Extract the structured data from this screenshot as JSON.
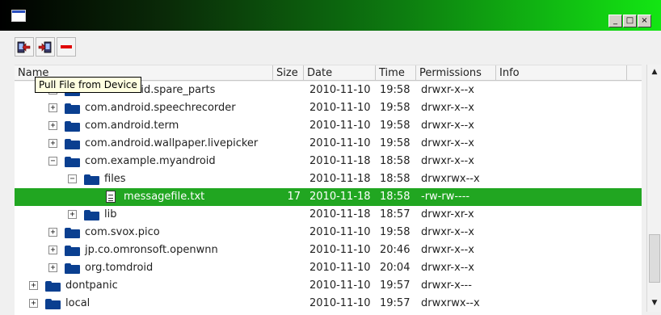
{
  "window": {
    "controls": {
      "minimize": "_",
      "maximize": "□",
      "close": "×"
    }
  },
  "toolbar": {
    "buttons": [
      {
        "name": "pull-file-button",
        "icon": "pull-file-icon"
      },
      {
        "name": "push-file-button",
        "icon": "push-file-icon"
      },
      {
        "name": "delete-button",
        "icon": "minus-icon"
      }
    ]
  },
  "tooltip": "Pull File from Device",
  "columns": [
    "Name",
    "Size",
    "Date",
    "Time",
    "Permissions",
    "Info"
  ],
  "rows": [
    {
      "name": "com.android.spare_parts",
      "size": "",
      "date": "2010-11-10",
      "time": "19:58",
      "perms": "drwxr-x--x",
      "type": "folder",
      "level": 2,
      "expander": "+",
      "selected": false
    },
    {
      "name": "com.android.speechrecorder",
      "size": "",
      "date": "2010-11-10",
      "time": "19:58",
      "perms": "drwxr-x--x",
      "type": "folder",
      "level": 2,
      "expander": "+",
      "selected": false
    },
    {
      "name": "com.android.term",
      "size": "",
      "date": "2010-11-10",
      "time": "19:58",
      "perms": "drwxr-x--x",
      "type": "folder",
      "level": 2,
      "expander": "+",
      "selected": false
    },
    {
      "name": "com.android.wallpaper.livepicker",
      "size": "",
      "date": "2010-11-10",
      "time": "19:58",
      "perms": "drwxr-x--x",
      "type": "folder",
      "level": 2,
      "expander": "+",
      "selected": false
    },
    {
      "name": "com.example.myandroid",
      "size": "",
      "date": "2010-11-18",
      "time": "18:58",
      "perms": "drwxr-x--x",
      "type": "folder",
      "level": 2,
      "expander": "−",
      "selected": false
    },
    {
      "name": "files",
      "size": "",
      "date": "2010-11-18",
      "time": "18:58",
      "perms": "drwxrwx--x",
      "type": "folder",
      "level": 3,
      "expander": "−",
      "selected": false
    },
    {
      "name": "messagefile.txt",
      "size": "17",
      "date": "2010-11-18",
      "time": "18:58",
      "perms": "-rw-rw----",
      "type": "file",
      "level": 4,
      "expander": "",
      "selected": true
    },
    {
      "name": "lib",
      "size": "",
      "date": "2010-11-18",
      "time": "18:57",
      "perms": "drwxr-xr-x",
      "type": "folder",
      "level": 3,
      "expander": "+",
      "selected": false
    },
    {
      "name": "com.svox.pico",
      "size": "",
      "date": "2010-11-10",
      "time": "19:58",
      "perms": "drwxr-x--x",
      "type": "folder",
      "level": 2,
      "expander": "+",
      "selected": false
    },
    {
      "name": "jp.co.omronsoft.openwnn",
      "size": "",
      "date": "2010-11-10",
      "time": "20:46",
      "perms": "drwxr-x--x",
      "type": "folder",
      "level": 2,
      "expander": "+",
      "selected": false
    },
    {
      "name": "org.tomdroid",
      "size": "",
      "date": "2010-11-10",
      "time": "20:04",
      "perms": "drwxr-x--x",
      "type": "folder",
      "level": 2,
      "expander": "+",
      "selected": false
    },
    {
      "name": "dontpanic",
      "size": "",
      "date": "2010-11-10",
      "time": "19:57",
      "perms": "drwxr-x---",
      "type": "folder",
      "level": 1,
      "expander": "+",
      "selected": false
    },
    {
      "name": "local",
      "size": "",
      "date": "2010-11-10",
      "time": "19:57",
      "perms": "drwxrwx--x",
      "type": "folder",
      "level": 1,
      "expander": "+",
      "selected": false
    }
  ],
  "colors": {
    "selection": "#21a621",
    "folder": "#0a3f90",
    "delete": "#e00000"
  }
}
